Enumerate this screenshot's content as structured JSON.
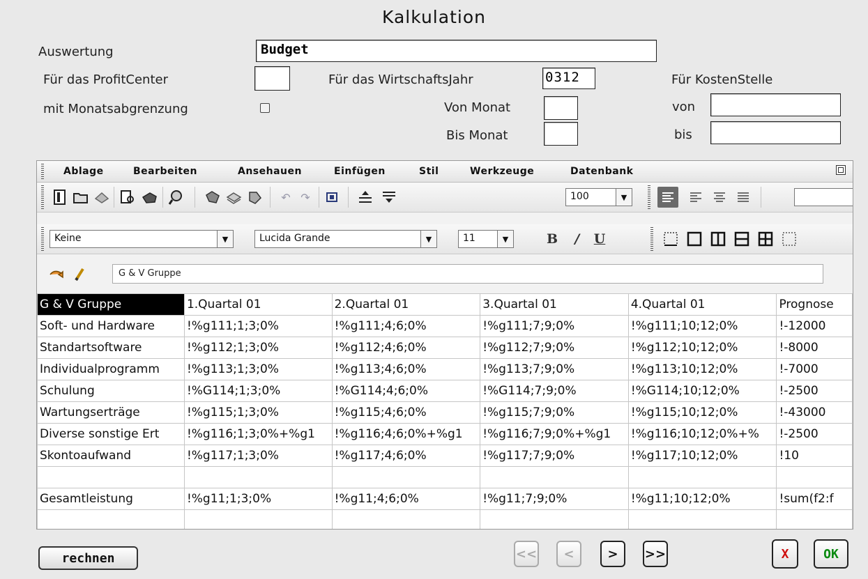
{
  "window": {
    "title": "Kalkulation"
  },
  "form": {
    "auswertung_label": "Auswertung",
    "auswertung_value": "Budget",
    "profitcenter_label": "Für das ProfitCenter",
    "profitcenter_value": "",
    "monatsabgrenzung_label": "mit Monatsabgrenzung",
    "monatsabgrenzung_checked": false,
    "wirtschaftsjahr_label": "Für das WirtschaftsJahr",
    "wirtschaftsjahr_value": "0312",
    "von_monat_label": "Von Monat",
    "von_monat_value": "",
    "bis_monat_label": "Bis Monat",
    "bis_monat_value": "",
    "kostenstelle_label": "Für KostenStelle",
    "von_label": "von",
    "von_value": "",
    "bis_label": "bis",
    "bis_value": ""
  },
  "sheet": {
    "menus": [
      "Ablage",
      "Bearbeiten",
      "Ansehauen",
      "Einfügen",
      "Stil",
      "Werkzeuge",
      "Datenbank"
    ],
    "zoom": "100",
    "style": "Keine",
    "font": "Lucida Grande",
    "size": "11",
    "formula": "G & V Gruppe",
    "rows": [
      [
        "G & V Gruppe",
        "1.Quartal 01",
        "2.Quartal 01",
        "3.Quartal 01",
        "4.Quartal 01",
        "Prognose"
      ],
      [
        "Soft- und Hardware",
        "!%g111;1;3;0%",
        "!%g111;4;6;0%",
        "!%g111;7;9;0%",
        "!%g111;10;12;0%",
        "!-12000"
      ],
      [
        "Standartsoftware",
        "!%g112;1;3;0%",
        "!%g112;4;6;0%",
        "!%g112;7;9;0%",
        "!%g112;10;12;0%",
        "!-8000"
      ],
      [
        "Individualprogramm",
        "!%g113;1;3;0%",
        "!%g113;4;6;0%",
        "!%g113;7;9;0%",
        "!%g113;10;12;0%",
        "!-7000"
      ],
      [
        "Schulung",
        "!%G114;1;3;0%",
        "!%G114;4;6;0%",
        "!%G114;7;9;0%",
        "!%G114;10;12;0%",
        "!-2500"
      ],
      [
        "Wartungserträge",
        "!%g115;1;3;0%",
        "!%g115;4;6;0%",
        "!%g115;7;9;0%",
        "!%g115;10;12;0%",
        "!-43000"
      ],
      [
        "Diverse sonstige Ert",
        "!%g116;1;3;0%+%g1",
        "!%g116;4;6;0%+%g1",
        "!%g116;7;9;0%+%g1",
        "!%g116;10;12;0%+%",
        "!-2500"
      ],
      [
        "Skontoaufwand",
        "!%g117;1;3;0%",
        "!%g117;4;6;0%",
        "!%g117;7;9;0%",
        "!%g117;10;12;0%",
        "!10"
      ],
      [
        "",
        "",
        "",
        "",
        "",
        ""
      ],
      [
        "Gesamtleistung",
        "!%g11;1;3;0%",
        "!%g11;4;6;0%",
        "!%g11;7;9;0%",
        "!%g11;10;12;0%",
        "!sum(f2:f"
      ],
      [
        "",
        "",
        "",
        "",
        "",
        ""
      ]
    ]
  },
  "buttons": {
    "rechnen": "rechnen",
    "first": "<<",
    "prev": "<",
    "next": ">",
    "last": ">>",
    "cancel": "X",
    "ok": "OK"
  }
}
